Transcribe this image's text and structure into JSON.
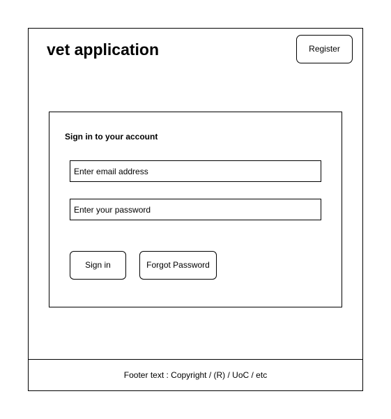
{
  "header": {
    "title": "vet application",
    "register_label": "Register"
  },
  "login": {
    "heading": "Sign in to your account",
    "email_placeholder": "Enter email address",
    "email_value": "",
    "password_placeholder": "Enter your password",
    "password_value": "",
    "signin_label": "Sign in",
    "forgot_label": "Forgot Password"
  },
  "footer": {
    "text": "Footer text : Copyright / (R) / UoC / etc"
  }
}
